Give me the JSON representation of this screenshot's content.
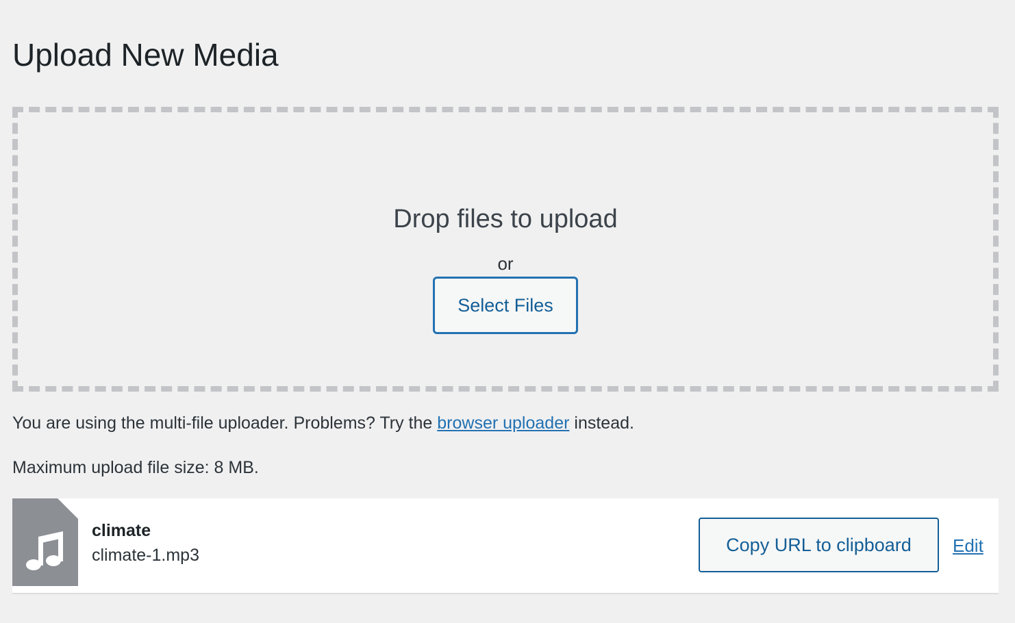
{
  "page": {
    "title": "Upload New Media"
  },
  "dropzone": {
    "title": "Drop files to upload",
    "or": "or",
    "select_button": "Select Files"
  },
  "uploader_note": {
    "before": "You are using the multi-file uploader. Problems? Try the ",
    "link": "browser uploader",
    "after": " instead."
  },
  "max_size": "Maximum upload file size: 8 MB.",
  "media_item": {
    "icon": "audio-file-icon",
    "title": "climate",
    "filename": "climate-1.mp3",
    "copy_button": "Copy URL to clipboard",
    "edit_link": "Edit"
  },
  "colors": {
    "background": "#f0f0f1",
    "accent": "#2271b1",
    "button_text": "#135e96",
    "dashed_border": "#c3c4c7",
    "thumb_bg": "#8c8f94"
  }
}
